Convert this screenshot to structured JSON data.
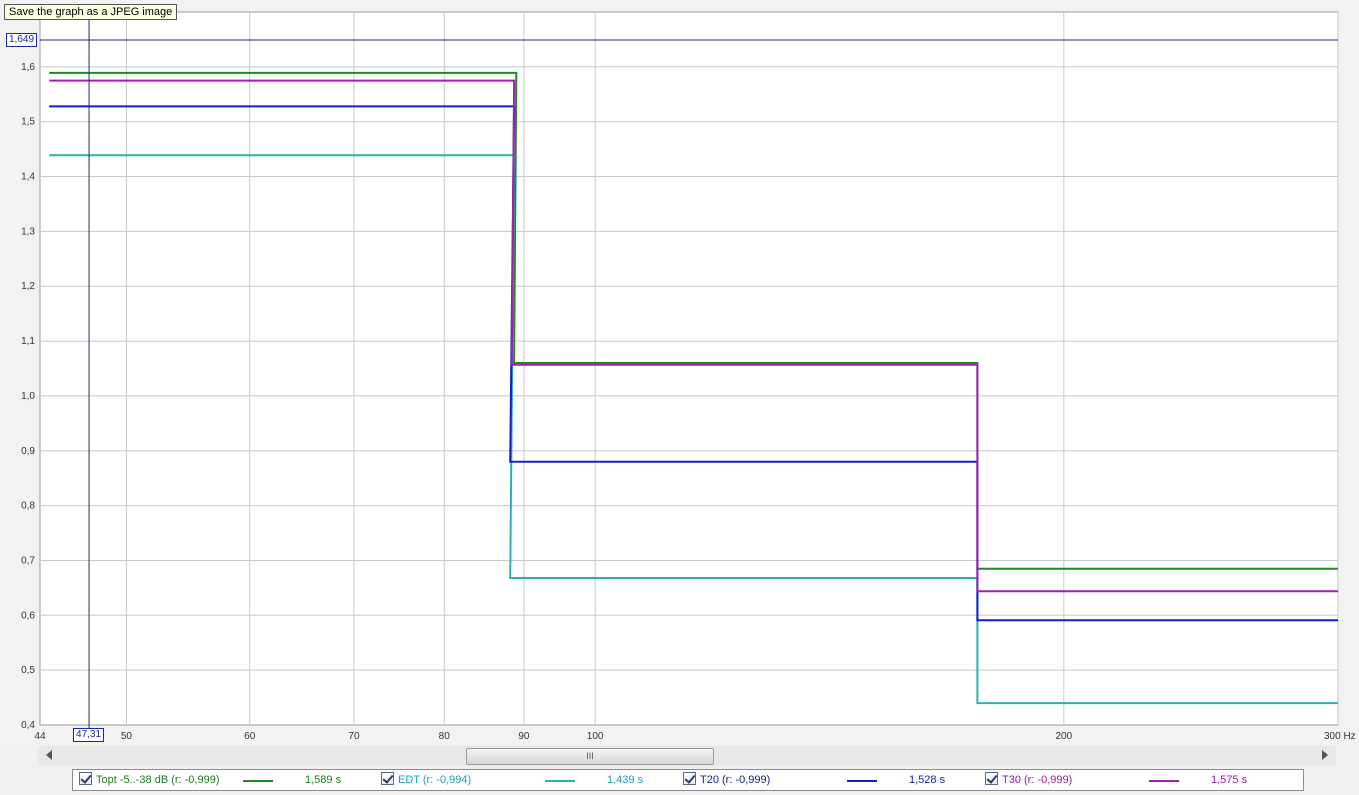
{
  "tooltip": "Save the graph as a JPEG image",
  "cursor": {
    "y_readout": "1,649",
    "x_readout": "47,31",
    "x": 47.31,
    "y": 1.649
  },
  "scrollbar": {
    "thumb_grip": "III"
  },
  "chart_data": {
    "type": "line",
    "title": "",
    "xlabel": "",
    "ylabel": "",
    "x_unit": "Hz",
    "x_scale": "log",
    "xlim": [
      44,
      300
    ],
    "ylim": [
      0.4,
      1.649
    ],
    "grid": true,
    "legend_position": "bottom",
    "x_ticks": [
      {
        "value": 44,
        "label": "44"
      },
      {
        "value": 50,
        "label": "50"
      },
      {
        "value": 60,
        "label": "60"
      },
      {
        "value": 70,
        "label": "70"
      },
      {
        "value": 80,
        "label": "80"
      },
      {
        "value": 90,
        "label": "90"
      },
      {
        "value": 100,
        "label": "100"
      },
      {
        "value": 200,
        "label": "200"
      },
      {
        "value": 300,
        "label": "300 Hz"
      }
    ],
    "x_grid": [
      50,
      60,
      70,
      80,
      90,
      100,
      200,
      300
    ],
    "y_ticks": [
      {
        "value": 0.4,
        "label": "0,4"
      },
      {
        "value": 0.5,
        "label": "0,5"
      },
      {
        "value": 0.6,
        "label": "0,6"
      },
      {
        "value": 0.7,
        "label": "0,7"
      },
      {
        "value": 0.8,
        "label": "0,8"
      },
      {
        "value": 0.9,
        "label": "0,9"
      },
      {
        "value": 1.0,
        "label": "1,0"
      },
      {
        "value": 1.1,
        "label": "1,1"
      },
      {
        "value": 1.2,
        "label": "1,2"
      },
      {
        "value": 1.3,
        "label": "1,3"
      },
      {
        "value": 1.4,
        "label": "1,4"
      },
      {
        "value": 1.5,
        "label": "1,5"
      },
      {
        "value": 1.6,
        "label": "1,6"
      }
    ],
    "series": [
      {
        "name": "Topt -5..-38 dB (r: -0,999)",
        "value_label": "1,589 s",
        "color": "#1f8a1f",
        "text_color": "#1f7a1f",
        "points": [
          [
            44.6,
            1.589
          ],
          [
            89.0,
            1.589
          ],
          [
            88.7,
            1.06
          ],
          [
            176.0,
            1.06
          ],
          [
            176.0,
            0.685
          ],
          [
            300,
            0.685
          ]
        ]
      },
      {
        "name": "EDT (r: -0,994)",
        "value_label": "1,439 s",
        "color": "#2ab0b0",
        "text_color": "#1aa0b0",
        "points": [
          [
            44.6,
            1.439
          ],
          [
            88.7,
            1.439
          ],
          [
            88.2,
            0.668
          ],
          [
            176.0,
            0.668
          ],
          [
            176.0,
            0.44
          ],
          [
            300,
            0.44
          ]
        ]
      },
      {
        "name": "T20 (r: -0,999)",
        "value_label": "1,528 s",
        "color": "#1a1ad0",
        "text_color": "#1a1a9a",
        "points": [
          [
            44.6,
            1.528
          ],
          [
            88.7,
            1.528
          ],
          [
            88.2,
            0.88
          ],
          [
            176.0,
            0.88
          ],
          [
            176.0,
            0.591
          ],
          [
            300,
            0.591
          ]
        ]
      },
      {
        "name": "T30 (r: -0,999)",
        "value_label": "1,575 s",
        "color": "#a020b0",
        "text_color": "#9a1aa0",
        "points": [
          [
            44.6,
            1.575
          ],
          [
            88.7,
            1.575
          ],
          [
            88.4,
            1.057
          ],
          [
            176.0,
            1.057
          ],
          [
            176.0,
            0.644
          ],
          [
            300,
            0.644
          ]
        ]
      }
    ]
  }
}
